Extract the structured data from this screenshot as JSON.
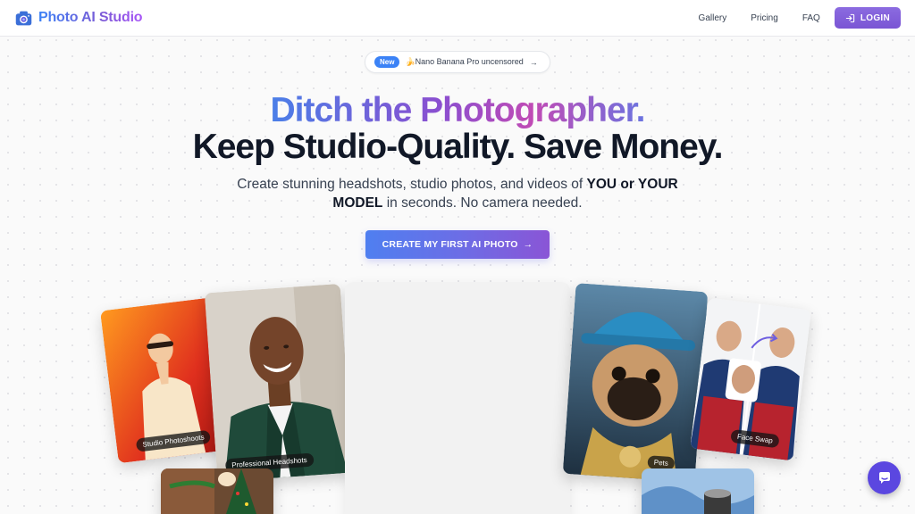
{
  "header": {
    "brand": "Photo AI Studio",
    "nav": [
      "Gallery",
      "Pricing",
      "FAQ"
    ],
    "login_label": "LOGIN"
  },
  "announcement": {
    "badge": "New",
    "text": "🍌Nano Banana Pro uncensored",
    "arrow": "→"
  },
  "hero": {
    "title_line1": "Ditch the Photographer.",
    "title_line2": "Keep Studio-Quality. Save Money.",
    "subtitle_part1": "Create stunning headshots, studio photos, and videos of ",
    "subtitle_bold1": "YOU or YOUR MODEL",
    "subtitle_part2": " in seconds. No camera needed.",
    "cta_label": "CREATE MY FIRST AI PHOTO",
    "cta_arrow": "→"
  },
  "gallery": [
    {
      "label": "Studio Photoshoots"
    },
    {
      "label": "Professional Headshots"
    },
    {
      "label": "Pets"
    },
    {
      "label": "Face Swap"
    }
  ],
  "icons": {
    "logo": "camera-icon",
    "login": "sign-in-icon",
    "chat": "chat-icon"
  },
  "colors": {
    "brand_blue": "#3b82f6",
    "brand_purple": "#7c5cd6",
    "login_bg": "#7a55d4",
    "chat_bg": "#5b47e0"
  }
}
